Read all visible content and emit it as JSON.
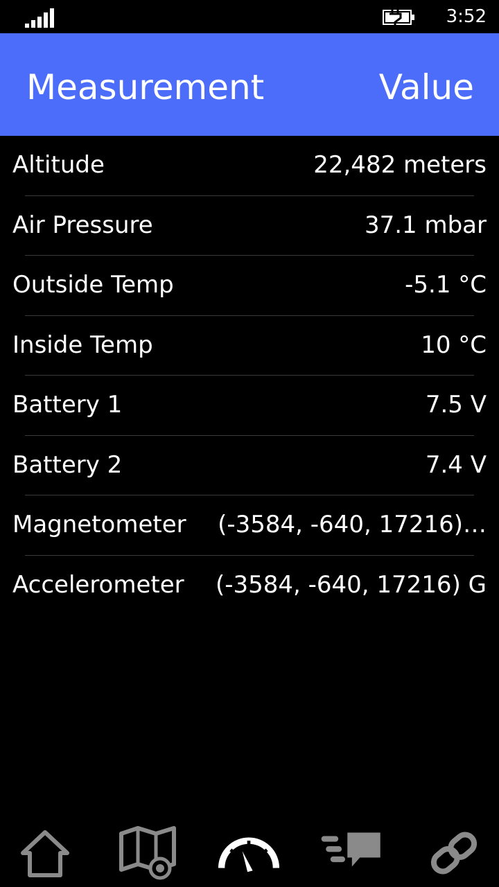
{
  "status_bar": {
    "time": "3:52",
    "signal_icon": "signal-bars-icon",
    "battery_icon": "battery-charging-icon"
  },
  "header": {
    "measurement_label": "Measurement",
    "value_label": "Value",
    "background_color": "#4b6dfa"
  },
  "rows": [
    {
      "label": "Altitude",
      "value": "22,482 meters"
    },
    {
      "label": "Air Pressure",
      "value": "37.1 mbar"
    },
    {
      "label": "Outside Temp",
      "value": "-5.1 °C"
    },
    {
      "label": "Inside Temp",
      "value": "10 °C"
    },
    {
      "label": "Battery 1",
      "value": "7.5 V"
    },
    {
      "label": "Battery 2",
      "value": "7.4 V"
    },
    {
      "label": "Magnetometer",
      "value": "(-3584, -640, 17216)…"
    },
    {
      "label": "Accelerometer",
      "value": "(-3584, -640, 17216) G"
    }
  ],
  "bottom_nav": {
    "items": [
      {
        "icon": "home-icon",
        "active": false
      },
      {
        "icon": "map-icon",
        "active": false
      },
      {
        "icon": "gauge-icon",
        "active": true
      },
      {
        "icon": "messages-icon",
        "active": false
      },
      {
        "icon": "link-icon",
        "active": false
      }
    ],
    "active_color": "#ffffff",
    "inactive_color": "#8a8a8a"
  }
}
